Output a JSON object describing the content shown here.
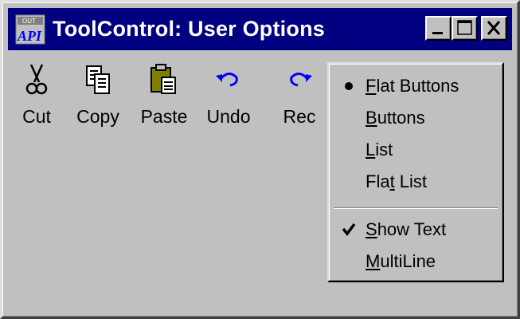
{
  "window": {
    "title": "ToolControl: User Options",
    "app_icon": "vb-api-icon",
    "controls": [
      "minimize-icon",
      "maximize-icon",
      "close-icon"
    ]
  },
  "toolbar": {
    "buttons": [
      {
        "label": "Cut",
        "icon": "scissors-icon"
      },
      {
        "label": "Copy",
        "icon": "copy-icon"
      },
      {
        "label": "Paste",
        "icon": "paste-icon"
      },
      {
        "label": "Undo",
        "icon": "undo-icon"
      },
      {
        "label": "Rec",
        "icon": "redo-icon"
      }
    ]
  },
  "context_menu": {
    "items": [
      {
        "pre": "",
        "accel": "F",
        "post": "lat Buttons",
        "mark": "bullet",
        "checked": true
      },
      {
        "pre": "",
        "accel": "B",
        "post": "uttons",
        "mark": "",
        "checked": false
      },
      {
        "pre": "",
        "accel": "L",
        "post": "ist",
        "mark": "",
        "checked": false
      },
      {
        "pre": "Fla",
        "accel": "t",
        "post": " List",
        "mark": "",
        "checked": false
      },
      {
        "pre": "",
        "accel": "S",
        "post": "how Text",
        "mark": "check",
        "checked": true
      },
      {
        "pre": "",
        "accel": "M",
        "post": "ultiLine",
        "mark": "",
        "checked": false
      }
    ]
  },
  "colors": {
    "titlebar": "#000080",
    "face": "#c0c0c0",
    "accent_icon_blue": "#0000ff"
  }
}
